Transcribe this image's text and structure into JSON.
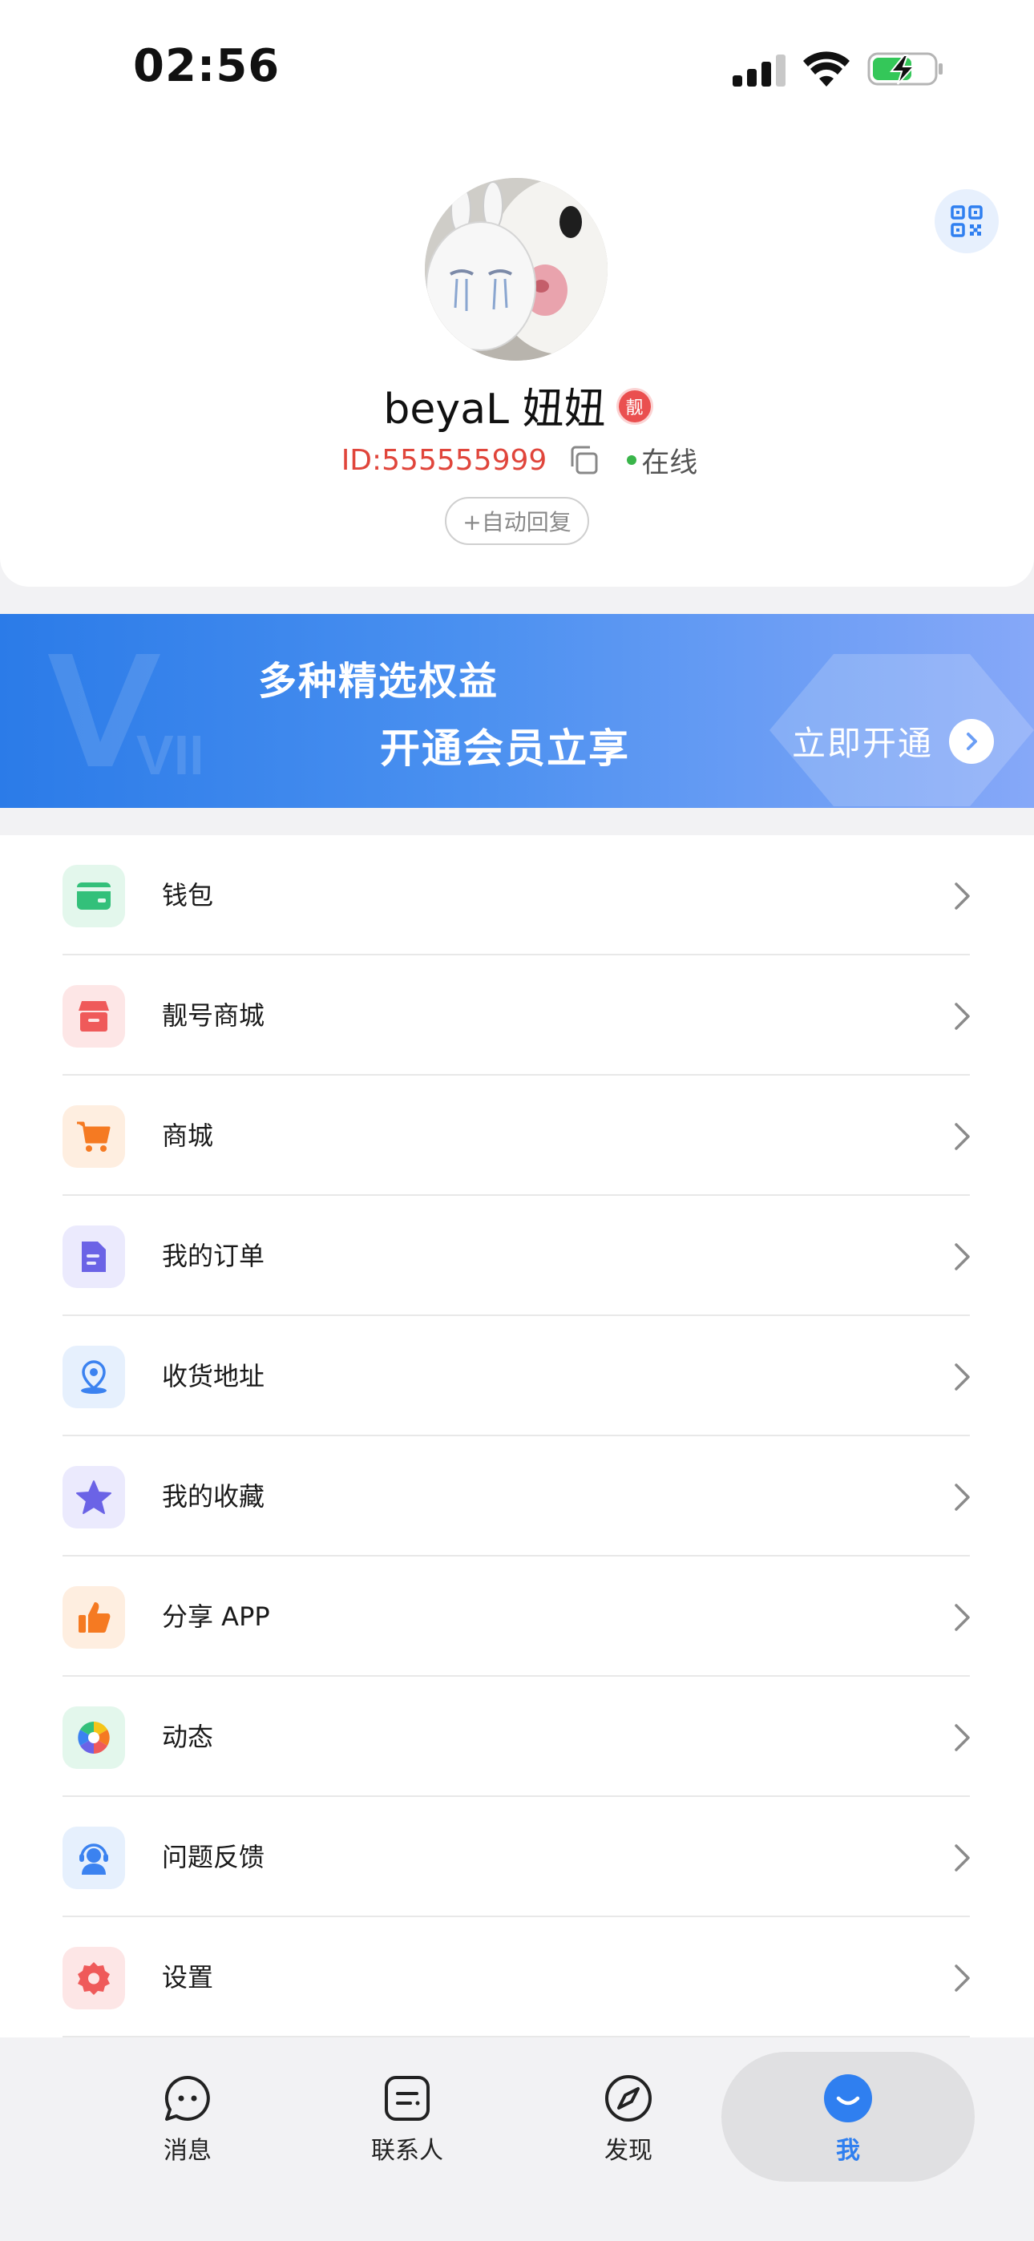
{
  "status_bar": {
    "time": "02:56"
  },
  "profile": {
    "nickname": "beyaL 妞妞",
    "badge_text": "靓",
    "user_id": "ID:555555999",
    "online_status": "在线",
    "auto_reply_label": "+自动回复"
  },
  "vip_banner": {
    "line1": "多种精选权益",
    "line2": "开通会员立享",
    "button_label": "立即开通",
    "watermark": "VIP"
  },
  "menu": {
    "items": [
      {
        "label": "钱包",
        "icon": "wallet-icon",
        "color": "#33c07a",
        "bg": "#e3f7ec"
      },
      {
        "label": "靓号商城",
        "icon": "store-icon",
        "color": "#ef5a5a",
        "bg": "#fde6e6"
      },
      {
        "label": "商城",
        "icon": "cart-icon",
        "color": "#f57a22",
        "bg": "#feeee0"
      },
      {
        "label": "我的订单",
        "icon": "document-icon",
        "color": "#6b63e6",
        "bg": "#ebeafd"
      },
      {
        "label": "收货地址",
        "icon": "location-icon",
        "color": "#3b82f0",
        "bg": "#e6f0fd"
      },
      {
        "label": "我的收藏",
        "icon": "star-icon",
        "color": "#6b63e6",
        "bg": "#ebeafd"
      },
      {
        "label": "分享 APP",
        "icon": "thumbs-up-icon",
        "color": "#f57a22",
        "bg": "#feeee0"
      },
      {
        "label": "动态",
        "icon": "aperture-icon",
        "color": "#33c07a",
        "bg": "#e3f7ec"
      },
      {
        "label": "问题反馈",
        "icon": "customer-service-icon",
        "color": "#3b82f0",
        "bg": "#e6f0fd"
      },
      {
        "label": "设置",
        "icon": "gear-icon",
        "color": "#ef5a5a",
        "bg": "#fde6e6"
      }
    ]
  },
  "tab_bar": {
    "tabs": [
      {
        "label": "消息",
        "icon": "chat-bubble-icon"
      },
      {
        "label": "联系人",
        "icon": "contacts-icon"
      },
      {
        "label": "发现",
        "icon": "compass-icon"
      },
      {
        "label": "我",
        "icon": "smile-icon",
        "active": true
      }
    ],
    "active_color": "#2f7ff0"
  }
}
